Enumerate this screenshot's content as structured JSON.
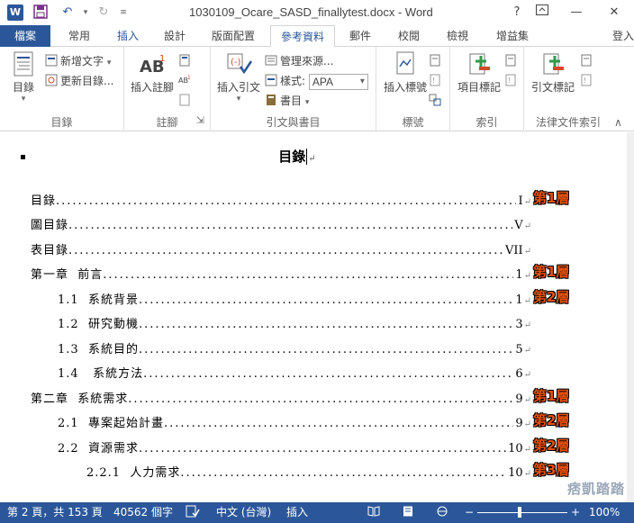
{
  "title_bar": {
    "document_title": "1030109_Ocare_SASD_finallytest.docx - Word",
    "help": "?",
    "minimize": "—",
    "close": "✕"
  },
  "tabs": {
    "file": "檔案",
    "items": [
      "常用",
      "插入",
      "設計",
      "版面配置",
      "參考資料",
      "郵件",
      "校閱",
      "檢視",
      "增益集"
    ],
    "active": "參考資料",
    "sign_in": "登入"
  },
  "ribbon": {
    "toc_group": {
      "label": "目錄",
      "toc_button": "目錄",
      "add_text": "新增文字",
      "update_table": "更新目錄..."
    },
    "footnotes_group": {
      "label": "註腳",
      "insert_footnote": "插入註腳"
    },
    "citations_group": {
      "label": "引文與書目",
      "insert_citation": "插入引文",
      "manage_sources": "管理來源...",
      "style_label": "樣式:",
      "style_value": "APA",
      "bibliography": "書目"
    },
    "captions_group": {
      "label": "標號",
      "insert_caption": "插入標號"
    },
    "index_group": {
      "label": "索引",
      "mark_entry": "項目標記"
    },
    "toa_group": {
      "label": "法律文件索引",
      "mark_citation": "引文標記"
    }
  },
  "document": {
    "heading": "目錄",
    "toc_entries": [
      {
        "label": "目錄",
        "page": "I",
        "annotation": "第1層"
      },
      {
        "label": "圖目錄",
        "page": "V",
        "annotation": ""
      },
      {
        "label": "表目錄",
        "page": "VII",
        "annotation": ""
      },
      {
        "label": "第一章  前言",
        "page": "1",
        "annotation": "第1層"
      },
      {
        "label": "1.1  系統背景",
        "page": "1",
        "annotation": "第2層"
      },
      {
        "label": "1.2  研究動機",
        "page": "3",
        "annotation": ""
      },
      {
        "label": "1.3  系統目的",
        "page": "5",
        "annotation": ""
      },
      {
        "label": "1.4   系統方法",
        "page": "6",
        "annotation": ""
      },
      {
        "label": "第二章  系統需求",
        "page": "9",
        "annotation": "第1層"
      },
      {
        "label": "2.1  專案起始計畫",
        "page": "9",
        "annotation": "第2層"
      },
      {
        "label": "2.2  資源需求",
        "page": "10",
        "annotation": "第2層"
      },
      {
        "label": "2.2.1  人力需求",
        "page": "10",
        "annotation": "第3層"
      }
    ]
  },
  "status_bar": {
    "page_info": "第 2 頁，共 153 頁",
    "word_count": "40562 個字",
    "language": "中文 (台灣)",
    "mode": "插入",
    "zoom": "100%"
  },
  "watermark": "痞凱踏踏",
  "colors": {
    "accent": "#2b579a",
    "annotation": "#e8510b"
  }
}
